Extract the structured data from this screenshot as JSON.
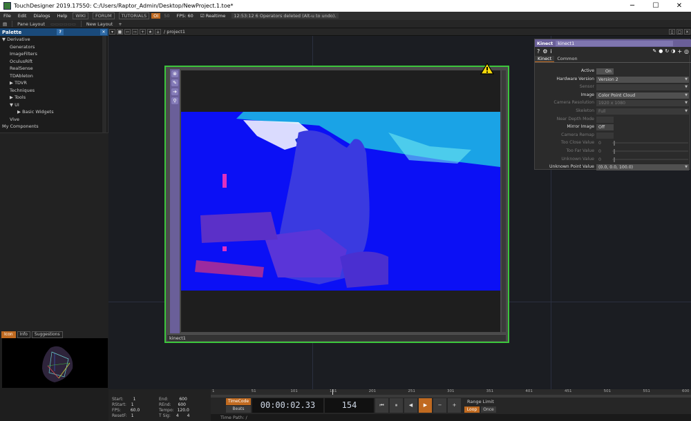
{
  "titlebar": {
    "title": "TouchDesigner 2019.17550: C:/Users/Raptor_Admin/Desktop/NewProject.1.toe*",
    "minimize": "─",
    "maximize": "☐",
    "close": "✕"
  },
  "menubar": {
    "items": [
      "File",
      "Edit",
      "Dialogs",
      "Help"
    ],
    "links": [
      "WIKI",
      "FORUM",
      "TUTORIALS"
    ],
    "oi": "OI",
    "fps_label": "FPS:",
    "fps_val": "60",
    "fps_prefix": "50",
    "realtime": "Realtime",
    "status": "12:53:12 6 Operators deleted (Alt-u to undo)."
  },
  "toolbar": {
    "pane_layout": "Pane Layout",
    "new_layout": "New Layout",
    "plus": "+"
  },
  "palette": {
    "title": "Palette",
    "help": "?",
    "close": "✕",
    "items": [
      {
        "label": "▼ Derivative",
        "indent": 0
      },
      {
        "label": "Generators",
        "indent": 1
      },
      {
        "label": "ImageFilters",
        "indent": 1
      },
      {
        "label": "OculusRift",
        "indent": 1
      },
      {
        "label": "RealSense",
        "indent": 1
      },
      {
        "label": "TDAbleton",
        "indent": 1
      },
      {
        "label": "▶ TDVR",
        "indent": 1
      },
      {
        "label": "Techniques",
        "indent": 1
      },
      {
        "label": "▶ Tools",
        "indent": 1
      },
      {
        "label": "▼ UI",
        "indent": 1
      },
      {
        "label": "▶ Basic Widgets",
        "indent": 2
      },
      {
        "label": "Vive",
        "indent": 1
      },
      {
        "label": "My Components",
        "indent": 0
      }
    ]
  },
  "infotabs": [
    "Icon",
    "Info",
    "Suggestions"
  ],
  "network": {
    "path": "/ project1"
  },
  "node": {
    "name": "kinect1"
  },
  "params": {
    "optype": "Kinect",
    "name": "kinect1",
    "tabs": [
      "Kinect",
      "Common"
    ],
    "rows": [
      {
        "label": "Active",
        "value": "On",
        "kind": "toggle-on",
        "dim": false
      },
      {
        "label": "Hardware Version",
        "value": "Version 2",
        "kind": "menu",
        "dim": false
      },
      {
        "label": "Sensor",
        "value": "",
        "kind": "menu",
        "dim": true
      },
      {
        "label": "Image",
        "value": "Color Point Cloud",
        "kind": "menu",
        "dim": false
      },
      {
        "label": "Camera Resolution",
        "value": "1920 x 1080",
        "kind": "menu",
        "dim": true
      },
      {
        "label": "Skeleton",
        "value": "Full",
        "kind": "menu",
        "dim": true
      },
      {
        "label": "Near Depth Mode",
        "value": "",
        "kind": "toggle",
        "dim": true
      },
      {
        "label": "Mirror Image",
        "value": "Off",
        "kind": "toggle",
        "dim": false
      },
      {
        "label": "Camera Remap",
        "value": "",
        "kind": "toggle",
        "dim": true
      },
      {
        "label": "Too Close Value",
        "value": "0",
        "kind": "slider",
        "dim": true
      },
      {
        "label": "Too Far Value",
        "value": "0",
        "kind": "slider",
        "dim": true
      },
      {
        "label": "Unknown Value",
        "value": "0",
        "kind": "slider",
        "dim": true
      },
      {
        "label": "Unknown Point Value",
        "value": "(0.0, 0.0, 100.0)",
        "kind": "menu",
        "dim": false
      }
    ]
  },
  "timeline": {
    "ticks": [
      "1",
      "51",
      "101",
      "151",
      "201",
      "251",
      "301",
      "351",
      "401",
      "451",
      "501",
      "551",
      "600"
    ],
    "start": "1",
    "end": "600",
    "rstart": "1",
    "rend": "600",
    "fps": "60.0",
    "tempo": "120.0",
    "resetf": "1",
    "tsig_a": "4",
    "tsig_b": "4",
    "labels": {
      "start": "Start:",
      "end": "End:",
      "rstart": "RStart:",
      "rend": "REnd:",
      "fps": "FPS:",
      "tempo": "Tempo:",
      "resetf": "ResetF:",
      "tsig": "T Sig:"
    },
    "timecode_btn": "TimeCode",
    "beats_btn": "Beats",
    "timecode": "00:00:02.33",
    "frame": "154",
    "range_limit": "Range Limit",
    "loop": "Loop",
    "once": "Once",
    "time_path": "Time Path: /"
  },
  "colors": {
    "accent": "#c06a20",
    "node_border": "#3cc63c",
    "palette_header": "#1a4a7a",
    "param_header": "#6a5f99"
  }
}
